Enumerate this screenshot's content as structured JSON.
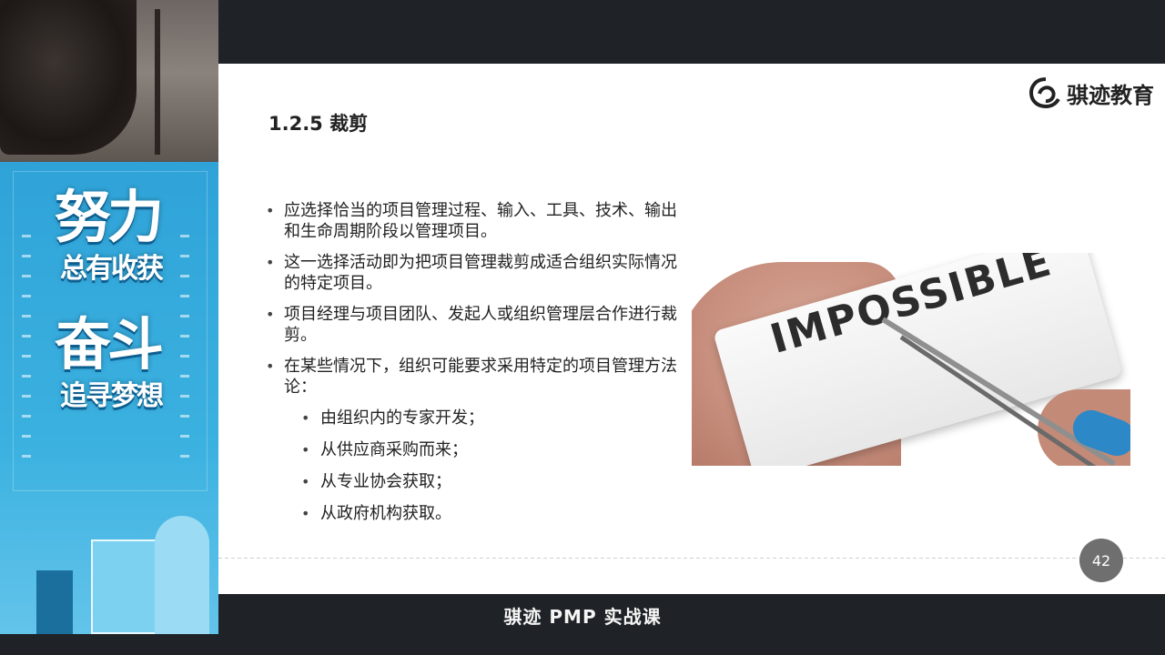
{
  "slide": {
    "brand": "骐迹教育",
    "heading": "1.2.5 裁剪",
    "bullets": [
      "应选择恰当的项目管理过程、输入、工具、技术、输出和生命周期阶段以管理项目。",
      "这一选择活动即为把项目管理裁剪成适合组织实际情况的特定项目。",
      "项目经理与项目团队、发起人或组织管理层合作进行裁剪。",
      "在某些情况下，组织可能要求采用特定的项目管理方法论："
    ],
    "sub_bullets": [
      "由组织内的专家开发；",
      "从供应商采购而来；",
      "从专业协会获取；",
      "从政府机构获取。"
    ],
    "image_word": "IMPOSSIBLE",
    "page_number": "42"
  },
  "poster": {
    "line1": "努力",
    "line2": "总有收获",
    "line3": "奋斗",
    "line4": "追寻梦想"
  },
  "caption": "骐迹 PMP 实战课",
  "colors": {
    "poster_blue": "#2fa3d8",
    "background": "#1f2226",
    "slide": "#ffffff",
    "page_circle": "#6f6f6f"
  }
}
